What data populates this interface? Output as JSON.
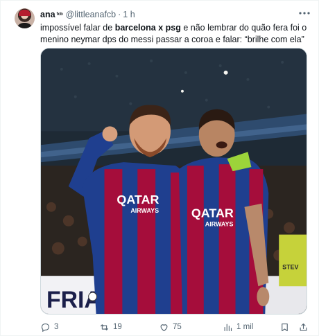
{
  "author": {
    "display_name": "ana",
    "badge_text": "ᶠᶜᵇ",
    "handle": "@littleanafcb",
    "separator": "·",
    "time": "1 h"
  },
  "tweet": {
    "text_part1": "impossível falar de ",
    "text_bold1": "barcelona x psg",
    "text_part2": " e não lembrar do quão fera foi o menino neymar dps do messi passar a coroa e falar: “brilhe com ela”"
  },
  "media": {
    "shirt_sponsor_left": "QATAR",
    "shirt_sponsor_left_sub": "AIRWAYS",
    "shirt_sponsor_right": "QATAR",
    "shirt_sponsor_right_sub": "AIRWAYS",
    "board_text": "FRIA",
    "board_text_right": "STEV",
    "colors": {
      "blaugrana_blue": "#1f3f8f",
      "blaugrana_red": "#a50d3b",
      "crowd": "#2b2520"
    }
  },
  "actions": {
    "replies": "3",
    "retweets": "19",
    "likes": "75",
    "views": "1 mil"
  },
  "icons": [
    "reply-icon",
    "retweet-icon",
    "like-icon",
    "views-icon",
    "bookmark-icon",
    "share-icon",
    "more-icon"
  ]
}
